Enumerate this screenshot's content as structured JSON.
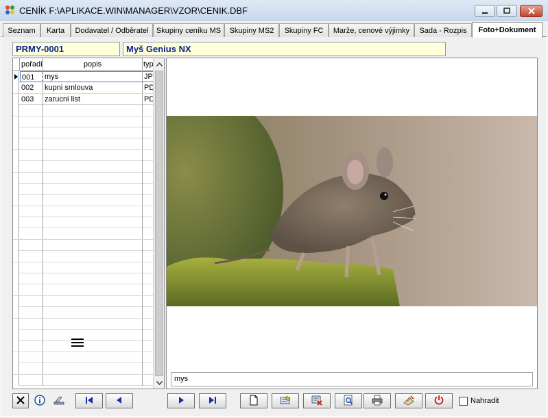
{
  "window": {
    "title": "CENÍK F:\\APLIKACE.WIN\\MANAGER\\VZOR\\CENIK.DBF"
  },
  "tabs": [
    {
      "label": "Seznam"
    },
    {
      "label": "Karta"
    },
    {
      "label": "Dodavatel / Odběratel"
    },
    {
      "label": "Skupiny ceníku MS"
    },
    {
      "label": "Skupiny MS2"
    },
    {
      "label": "Skupiny FC"
    },
    {
      "label": "Marže, cenové výjimky"
    },
    {
      "label": "Sada - Rozpis"
    },
    {
      "label": "Foto+Dokument"
    }
  ],
  "active_tab": "Foto+Dokument",
  "record": {
    "code": "PRMY-0001",
    "name": "Myš Genius NX"
  },
  "grid": {
    "columns": [
      "pořadí",
      "popis",
      "typ"
    ],
    "rows": [
      {
        "poradi": "001",
        "popis": "mys",
        "typ": "JPG"
      },
      {
        "poradi": "002",
        "popis": "kupni smlouva",
        "typ": "PDF"
      },
      {
        "poradi": "003",
        "popis": "zarucni list",
        "typ": "PDF"
      }
    ]
  },
  "image": {
    "caption": "mys"
  },
  "toolbar": {
    "replace_label": "Nahradit"
  },
  "colors": {
    "field_bg": "#ffffd9",
    "field_text": "#0a1f8f",
    "close_red": "#c4412b",
    "nav_blue": "#1a2f9e"
  }
}
